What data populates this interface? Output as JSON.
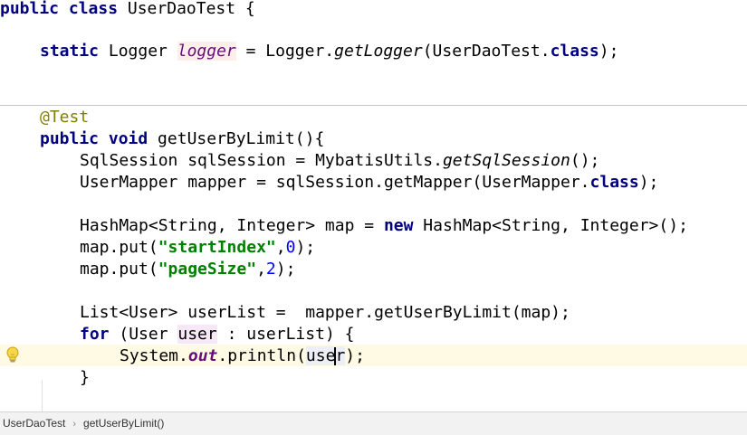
{
  "code": {
    "l1": {
      "kw": "public class",
      "name": " UserDaoTest {"
    },
    "l2": {
      "kw": "static",
      "t1": " Logger ",
      "field": "logger",
      "t2": " = Logger.",
      "call": "getLogger",
      "t3": "(UserDaoTest.",
      "cls": "class",
      "t4": ");"
    },
    "l3": {
      "ann": "@Test"
    },
    "l4": {
      "kw": "public void",
      "t1": " getUserByLimit(){"
    },
    "l5": {
      "t1": "SqlSession sqlSession = MybatisUtils.",
      "call": "getSqlSession",
      "t2": "();"
    },
    "l6": {
      "t1": "UserMapper mapper = sqlSession.getMapper(UserMapper.",
      "cls": "class",
      "t2": ");"
    },
    "l7": {
      "t1": "HashMap<String, Integer> map = ",
      "kw": "new",
      "t2": " HashMap<String, Integer>();"
    },
    "l8": {
      "t1": "map.put(",
      "str": "\"startIndex\"",
      "t2": ",",
      "num": "0",
      "t3": ");"
    },
    "l9": {
      "t1": "map.put(",
      "str": "\"pageSize\"",
      "t2": ",",
      "num": "2",
      "t3": ");"
    },
    "l10": {
      "t1": "List<User> userList =  mapper.getUserByLimit(map);"
    },
    "l11": {
      "kw": "for",
      "t1": " (User ",
      "var": "user",
      "t2": " : userList) {"
    },
    "l12": {
      "t1": "System.",
      "out": "out",
      "t2": ".println(",
      "var1": "use",
      "var2": "r",
      "t3": ");"
    },
    "l13": {
      "t1": "}"
    }
  },
  "breadcrumb": {
    "class_name": "UserDaoTest",
    "separator": "›",
    "method_name": "getUserByLimit()"
  },
  "icons": {
    "intention_bulb": "lightbulb-icon"
  },
  "colors": {
    "keyword": "#000080",
    "annotation": "#808000",
    "string": "#008000",
    "number": "#0000ff",
    "static_field": "#660e7a",
    "current_line": "#fffae3"
  }
}
